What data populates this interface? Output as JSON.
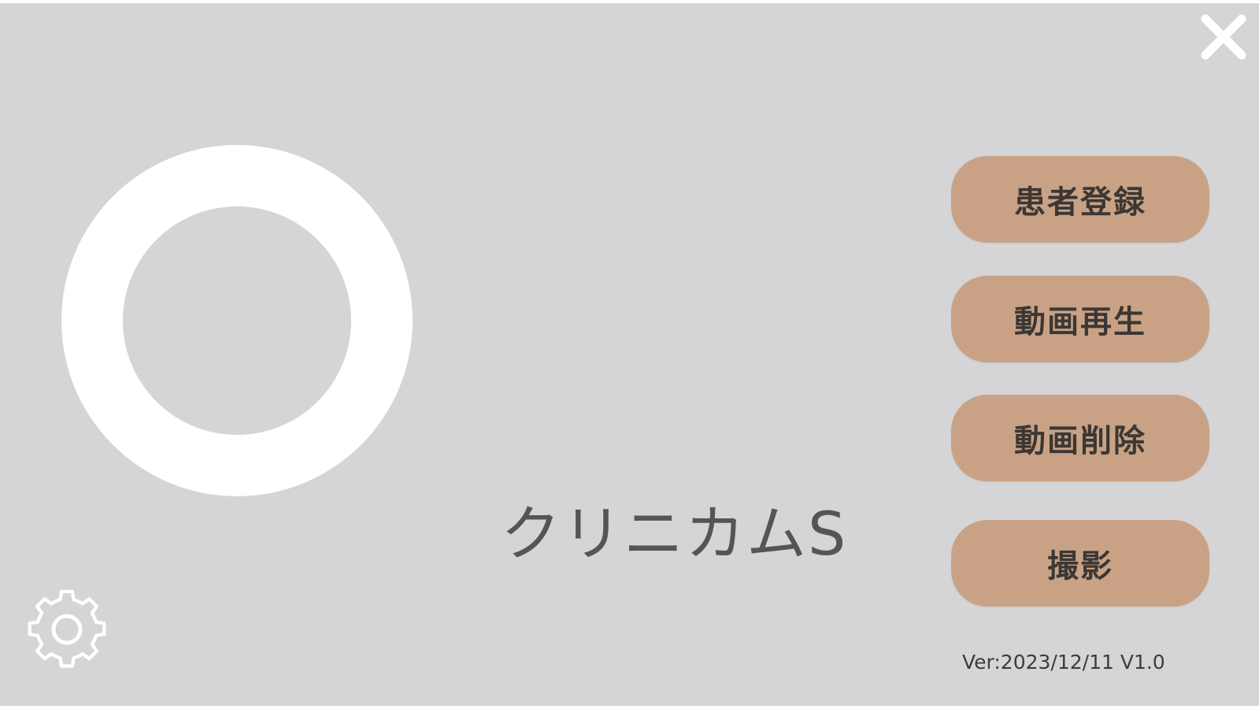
{
  "app": {
    "title": "クリニカムS",
    "version": "Ver:2023/12/11 V1.0"
  },
  "menu": {
    "buttons": [
      {
        "label": "患者登録"
      },
      {
        "label": "動画再生"
      },
      {
        "label": "動画削除"
      },
      {
        "label": "撮影"
      }
    ]
  },
  "icons": {
    "close": "close-icon",
    "settings": "gear-icon",
    "record": "record-ring-icon"
  },
  "colors": {
    "background": "#d5d5d7",
    "button": "#c9a286",
    "button_text": "#3c3734",
    "title_text": "#555558",
    "icon": "#ffffff"
  }
}
